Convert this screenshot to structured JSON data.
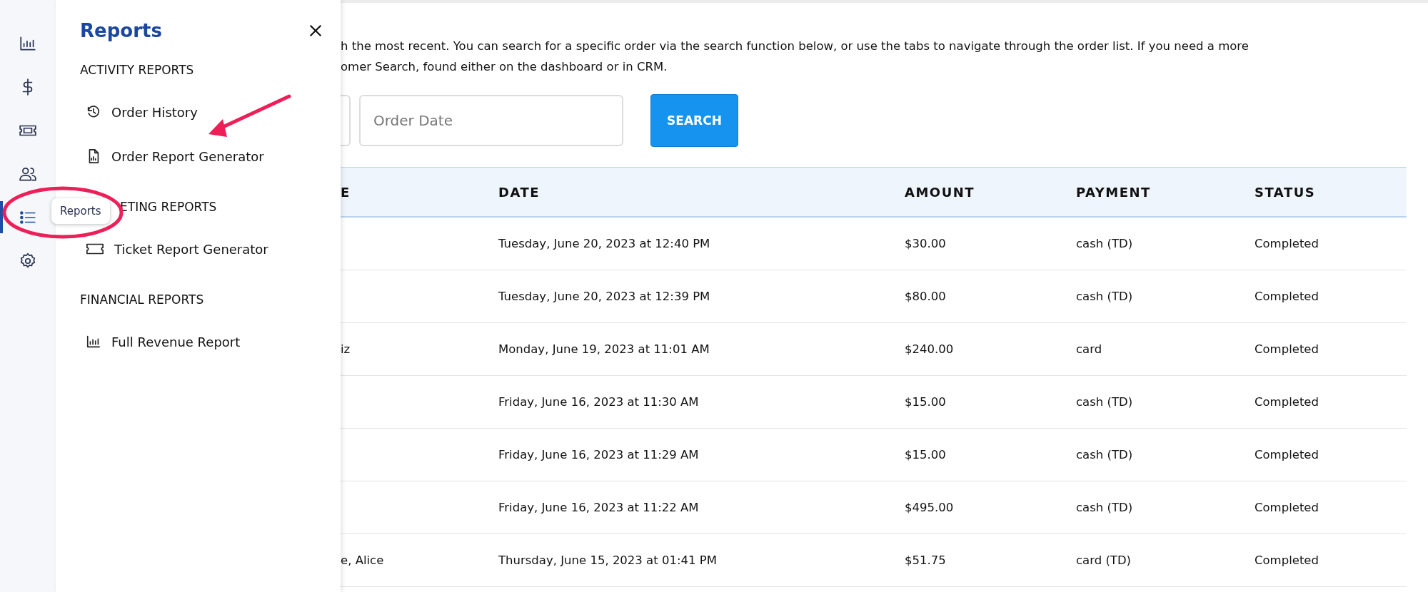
{
  "rail": [
    {
      "kind": "chart",
      "selected": false
    },
    {
      "kind": "dollar",
      "selected": false
    },
    {
      "kind": "ticket",
      "selected": false
    },
    {
      "kind": "people",
      "selected": false
    },
    {
      "kind": "list",
      "selected": true
    },
    {
      "kind": "gear",
      "selected": false
    }
  ],
  "tooltip": "Reports",
  "panel": {
    "title": "Reports",
    "sections": [
      {
        "heading": "ACTIVITY REPORTS",
        "items": [
          {
            "label": "Order History",
            "kind": "history"
          },
          {
            "label": "Order Report Generator",
            "kind": "file"
          }
        ]
      },
      {
        "heading": "ETING REPORTS",
        "items": [
          {
            "label": "Ticket Report Generator",
            "kind": "ticket"
          }
        ]
      },
      {
        "heading": "FINANCIAL REPORTS",
        "items": [
          {
            "label": "Full Revenue Report",
            "kind": "chart"
          }
        ]
      }
    ]
  },
  "intro_lines": [
    "h the most recent. You can search for a specific order via the search function below, or use the tabs to navigate through the order list. If you need a more",
    "omer Search, found either on the dashboard or in CRM."
  ],
  "search": {
    "placeholder": "Order Date",
    "button": "SEARCH"
  },
  "table": {
    "columns": [
      "E",
      "DATE",
      "AMOUNT",
      "PAYMENT",
      "STATUS"
    ],
    "rows": [
      {
        "date": "Tuesday, June 20, 2023 at 12:40 PM",
        "amount": "$30.00",
        "payment": "cash (TD)",
        "status": "Completed"
      },
      {
        "date": "Tuesday, June 20, 2023 at 12:39 PM",
        "amount": "$80.00",
        "payment": "cash (TD)",
        "status": "Completed"
      },
      {
        "name": "iz",
        "date": "Monday, June 19, 2023 at 11:01 AM",
        "amount": "$240.00",
        "payment": "card",
        "status": "Completed"
      },
      {
        "date": "Friday, June 16, 2023 at 11:30 AM",
        "amount": "$15.00",
        "payment": "cash (TD)",
        "status": "Completed"
      },
      {
        "date": "Friday, June 16, 2023 at 11:29 AM",
        "amount": "$15.00",
        "payment": "cash (TD)",
        "status": "Completed"
      },
      {
        "date": "Friday, June 16, 2023 at 11:22 AM",
        "amount": "$495.00",
        "payment": "cash (TD)",
        "status": "Completed"
      },
      {
        "name": "e, Alice",
        "date": "Thursday, June 15, 2023 at 01:41 PM",
        "amount": "$51.75",
        "payment": "card (TD)",
        "status": "Completed"
      }
    ]
  }
}
